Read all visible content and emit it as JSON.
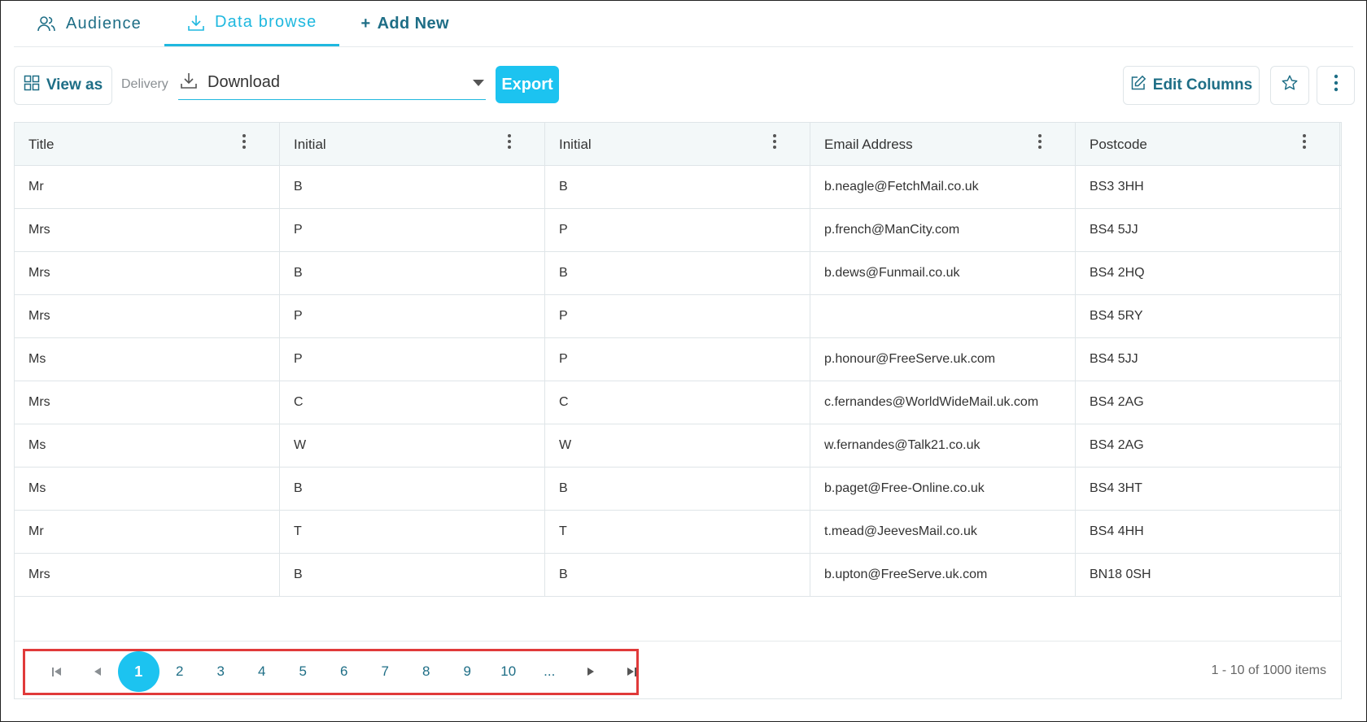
{
  "tabs": {
    "audience": "Audience",
    "data_browse": "Data browse",
    "add_new": "Add New",
    "add_new_prefix": "+"
  },
  "toolbar": {
    "view_as": "View as",
    "delivery_label": "Delivery",
    "delivery_value": "Download",
    "export": "Export",
    "edit_columns": "Edit Columns"
  },
  "table": {
    "headers": [
      "Title",
      "Initial",
      "Initial",
      "Email Address",
      "Postcode"
    ],
    "rows": [
      [
        "Mr",
        "B",
        "B",
        "b.neagle@FetchMail.co.uk",
        "BS3 3HH"
      ],
      [
        "Mrs",
        "P",
        "P",
        "p.french@ManCity.com",
        "BS4 5JJ"
      ],
      [
        "Mrs",
        "B",
        "B",
        "b.dews@Funmail.co.uk",
        "BS4 2HQ"
      ],
      [
        "Mrs",
        "P",
        "P",
        "",
        "BS4 5RY"
      ],
      [
        "Ms",
        "P",
        "P",
        "p.honour@FreeServe.uk.com",
        "BS4 5JJ"
      ],
      [
        "Mrs",
        "C",
        "C",
        "c.fernandes@WorldWideMail.uk.com",
        "BS4 2AG"
      ],
      [
        "Ms",
        "W",
        "W",
        "w.fernandes@Talk21.co.uk",
        "BS4 2AG"
      ],
      [
        "Ms",
        "B",
        "B",
        "b.paget@Free-Online.co.uk",
        "BS4 3HT"
      ],
      [
        "Mr",
        "T",
        "T",
        "t.mead@JeevesMail.co.uk",
        "BS4 4HH"
      ],
      [
        "Mrs",
        "B",
        "B",
        "b.upton@FreeServe.uk.com",
        "BN18 0SH"
      ]
    ]
  },
  "pager": {
    "pages": [
      "1",
      "2",
      "3",
      "4",
      "5",
      "6",
      "7",
      "8",
      "9",
      "10",
      "..."
    ],
    "current": "1",
    "info": "1 - 10 of 1000 items"
  },
  "colors": {
    "accent": "#1cc3f0",
    "tab_text": "#1e6e86",
    "highlight": "#e03a3a"
  }
}
